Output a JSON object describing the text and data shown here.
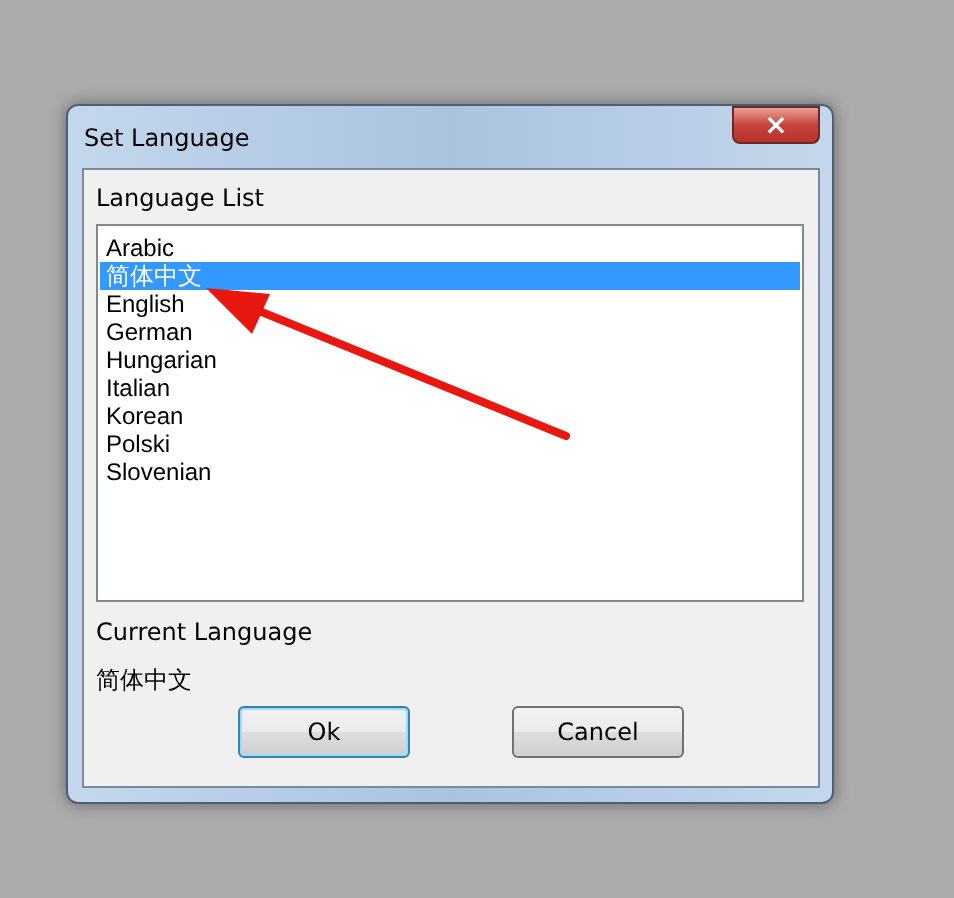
{
  "window": {
    "title": "Set Language",
    "close_label": "×"
  },
  "language_list": {
    "label": "Language List",
    "items": [
      {
        "label": "Arabic",
        "selected": false
      },
      {
        "label": "简体中文",
        "selected": true
      },
      {
        "label": "English",
        "selected": false
      },
      {
        "label": "German",
        "selected": false
      },
      {
        "label": "Hungarian",
        "selected": false
      },
      {
        "label": "Italian",
        "selected": false
      },
      {
        "label": "Korean",
        "selected": false
      },
      {
        "label": "Polski",
        "selected": false
      },
      {
        "label": "Slovenian",
        "selected": false
      }
    ]
  },
  "current_language": {
    "label": "Current Language",
    "value": "简体中文"
  },
  "buttons": [
    {
      "label": "Ok",
      "default": true
    },
    {
      "label": "Cancel",
      "default": false
    }
  ]
}
